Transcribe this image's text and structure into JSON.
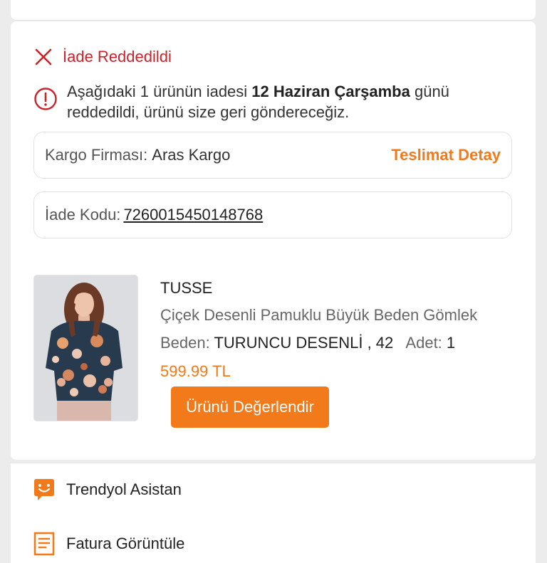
{
  "status": {
    "text": "İade Reddedildi",
    "color": "#c8242b",
    "icon": "close-icon"
  },
  "notice": {
    "icon": "info-icon",
    "text_before": "Aşağıdaki 1 ürünün iadesi ",
    "date_bold": "12 Haziran Çarşamba",
    "text_after": " günü reddedildi, ürünü size geri göndereceğiz."
  },
  "cargo": {
    "label": "Kargo Firması:",
    "value": "Aras Kargo",
    "link": "Teslimat Detay"
  },
  "return_code": {
    "label": "İade Kodu:",
    "value": "7260015450148768"
  },
  "product": {
    "brand": "TUSSE",
    "name": "Çiçek Desenli Pamuklu Büyük Beden Gömlek",
    "size_label": "Beden:",
    "size_value": "TURUNCU DESENLİ , 42",
    "qty_label": "Adet:",
    "qty_value": "1",
    "price": "599.99 TL",
    "rate_button": "Ürünü Değerlendir",
    "image": "product-photo"
  },
  "menu": [
    {
      "label": "Trendyol Asistan",
      "icon": "assistant-chat-icon"
    },
    {
      "label": "Fatura Görüntüle",
      "icon": "invoice-icon"
    }
  ],
  "colors": {
    "accent": "#f27a1a",
    "error": "#c8242b"
  }
}
